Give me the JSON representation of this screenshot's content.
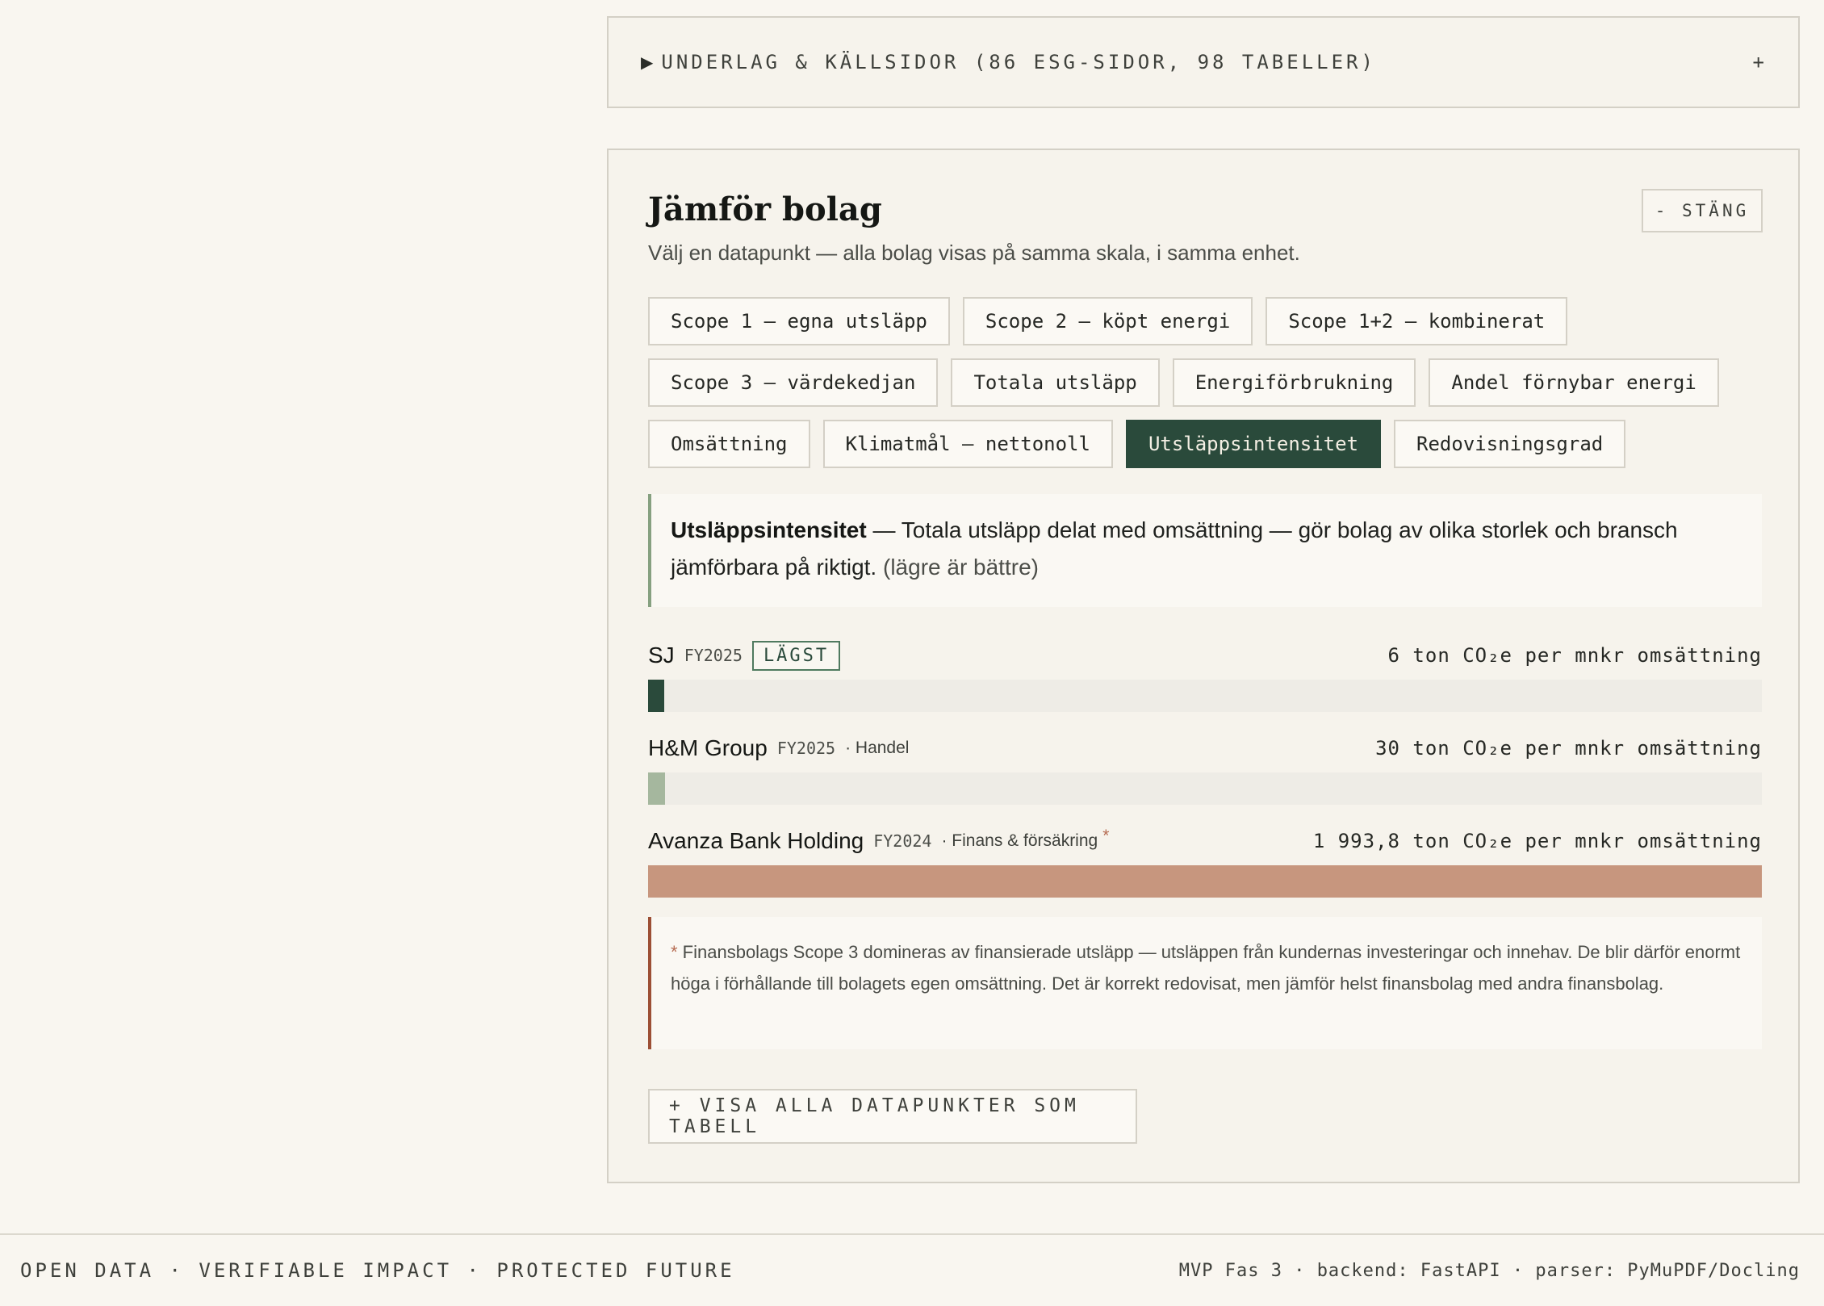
{
  "underlag": {
    "arrow": "▶",
    "label": "UNDERLAG & KÄLLSIDOR (86 ESG-SIDOR, 98 TABELLER)",
    "toggle": "+"
  },
  "compare": {
    "title": "Jämför bolag",
    "close_label": "- STÄNG",
    "subtitle": "Välj en datapunkt — alla bolag visas på samma skala, i samma enhet.",
    "chips_row1": [
      "Scope 1 — egna utsläpp",
      "Scope 2 — köpt energi",
      "Scope 1+2 — kombinerat"
    ],
    "chips_row2": [
      "Scope 3 — värdekedjan",
      "Totala utsläpp",
      "Energiförbrukning",
      "Andel förnybar energi"
    ],
    "chips_row3": [
      "Omsättning",
      "Klimatmål — nettonoll",
      "Utsläppsintensitet",
      "Redovisningsgrad"
    ],
    "active_chip": "Utsläppsintensitet",
    "description": {
      "term": "Utsläppsintensitet",
      "text": " — Totala utsläpp delat med omsättning — gör bolag av olika storlek och bransch jämförbara på riktigt.",
      "note": "(lägre är bättre)"
    },
    "companies": [
      {
        "name": "SJ",
        "fy": "FY2025",
        "badge": "LÄGST",
        "branch": "",
        "star": "",
        "value": 6,
        "value_text": "6 ton CO₂e per mnkr omsättning",
        "bar_color": "#2a4a3b"
      },
      {
        "name": "H&M Group",
        "fy": "FY2025",
        "badge": "",
        "branch": "· Handel",
        "star": "",
        "value": 30,
        "value_text": "30 ton CO₂e per mnkr omsättning",
        "bar_color": "#a5b79e"
      },
      {
        "name": "Avanza Bank Holding",
        "fy": "FY2024",
        "badge": "",
        "branch": "· Finans & försäkring",
        "star": "*",
        "value": 1993.8,
        "value_text": "1 993,8 ton CO₂e per mnkr omsättning",
        "bar_color": "#c7967e"
      }
    ],
    "footnote_star": "*",
    "footnote": " Finansbolags Scope 3 domineras av finansierade utsläpp — utsläppen från kundernas investeringar och innehav. De blir därför enormt höga i förhållande till bolagets egen omsättning. Det är korrekt redovisat, men jämför helst finansbolag med andra finansbolag.",
    "table_button": "+ VISA ALLA DATAPUNKTER SOM TABELL"
  },
  "footer": {
    "tagline": "OPEN DATA · VERIFIABLE IMPACT · PROTECTED FUTURE",
    "tech": "MVP Fas 3 · backend: FastAPI · parser: PyMuPDF/Docling"
  }
}
